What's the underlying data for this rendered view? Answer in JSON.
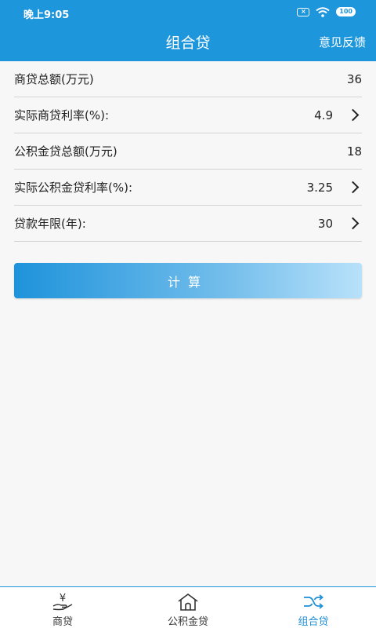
{
  "status_bar": {
    "time": "晚上9:05",
    "sim": "×",
    "battery": "100"
  },
  "header": {
    "title": "组合贷",
    "feedback": "意见反馈",
    "color": "#1e96dc"
  },
  "form": {
    "rows": [
      {
        "label": "商贷总额(万元)",
        "value": "36",
        "has_chevron": false
      },
      {
        "label": "实际商贷利率(%):",
        "value": "4.9",
        "has_chevron": true
      },
      {
        "label": "公积金贷总额(万元)",
        "value": "18",
        "has_chevron": false
      },
      {
        "label": "实际公积金贷利率(%):",
        "value": "3.25",
        "has_chevron": true
      },
      {
        "label": "贷款年限(年):",
        "value": "30",
        "has_chevron": true
      }
    ]
  },
  "calculate_button": {
    "label": "计算"
  },
  "tabbar": {
    "tabs": [
      {
        "label": "商贷",
        "icon": "hand-yen-icon",
        "active": false
      },
      {
        "label": "公积金贷",
        "icon": "house-icon",
        "active": false
      },
      {
        "label": "组合贷",
        "icon": "shuffle-icon",
        "active": true
      }
    ],
    "active_color": "#1e8fd6"
  }
}
